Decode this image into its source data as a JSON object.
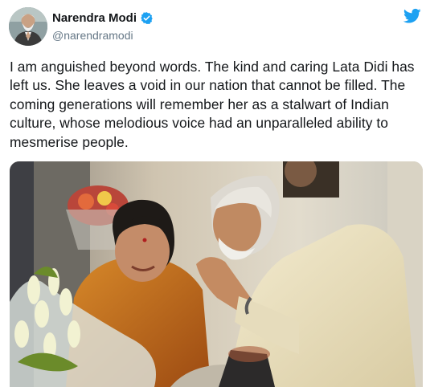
{
  "author": {
    "display_name": "Narendra Modi",
    "handle": "@narendramodi",
    "avatar_icon": "avatar-photo",
    "verified_icon": "verified-badge-icon",
    "verified_color": "#1da1f2"
  },
  "platform": {
    "logo_icon": "twitter-bird-icon",
    "brand_color": "#1da1f2"
  },
  "tweet": {
    "text": "I am anguished beyond words. The kind and caring Lata Didi has left us. She leaves a void in our nation that cannot be filled. The coming generations will remember her as a stalwart of Indian culture, whose melodious voice had an unparalleled ability to mesmerise people."
  },
  "media": {
    "type": "photo",
    "icon": "tweet-photo"
  }
}
